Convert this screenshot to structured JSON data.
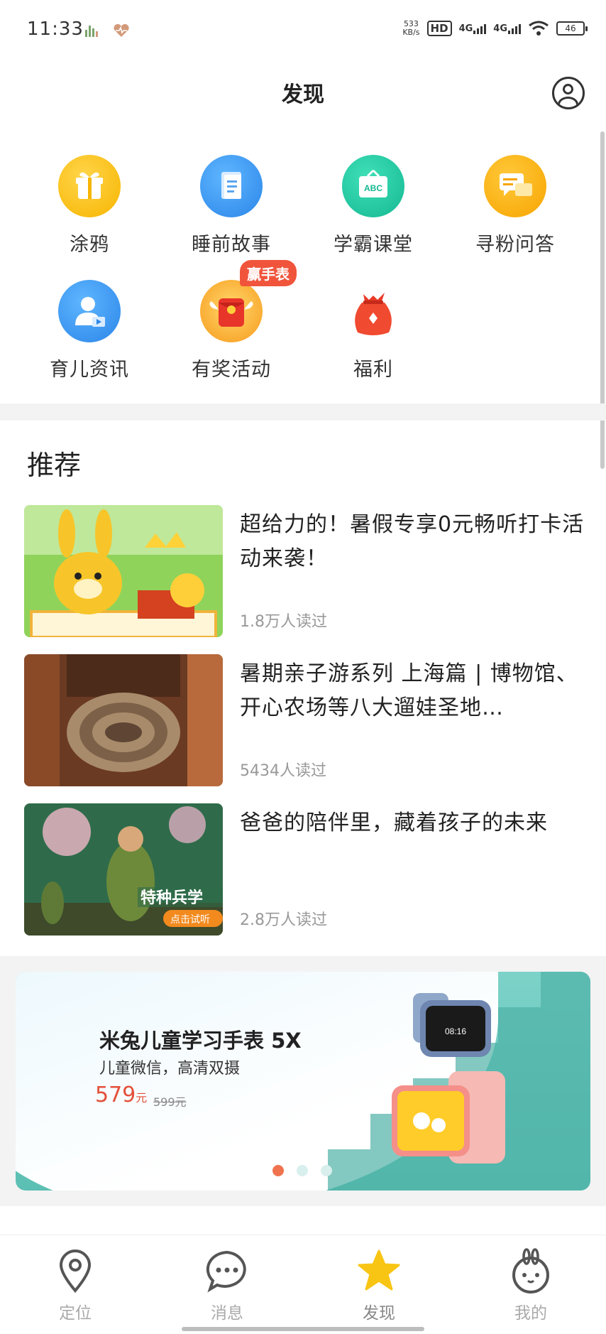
{
  "status_bar": {
    "time": "11:33",
    "speed_value": "533",
    "speed_unit": "KB/s",
    "hd_label": "HD",
    "sim1_label": "4G",
    "sim2_label": "4G",
    "battery": "46"
  },
  "header": {
    "title": "发现"
  },
  "grid": {
    "items": [
      {
        "label": "涂鸦",
        "icon": "gift-icon"
      },
      {
        "label": "睡前故事",
        "icon": "book-icon"
      },
      {
        "label": "学霸课堂",
        "icon": "abc-board-icon"
      },
      {
        "label": "寻粉问答",
        "icon": "chat-bubbles-icon"
      },
      {
        "label": "育儿资讯",
        "icon": "parent-video-icon"
      },
      {
        "label": "有奖活动",
        "icon": "red-envelope-icon"
      },
      {
        "label": "福利",
        "icon": "lucky-bag-icon"
      }
    ],
    "win_badge": "赢手表"
  },
  "recommend": {
    "title": "推荐",
    "articles": [
      {
        "title": "超给力的！暑假专享0元畅听打卡活动来袭！",
        "reads": "1.8万人读过"
      },
      {
        "title": "暑期亲子游系列 上海篇 | 博物馆、开心农场等八大遛娃圣地…",
        "reads": "5434人读过"
      },
      {
        "title": "爸爸的陪伴里，藏着孩子的未来",
        "reads": "2.8万人读过"
      }
    ],
    "thumb3_overlay": "特种兵学",
    "thumb3_button": "点击试听"
  },
  "banner": {
    "title": "米兔儿童学习手表 5X",
    "subtitle": "儿童微信，高清双摄",
    "price": "579",
    "price_unit": "元",
    "old_price": "599元",
    "watch_time": "08:16",
    "slides": 3,
    "active_slide": 1
  },
  "bottom_nav": {
    "items": [
      {
        "label": "定位",
        "icon": "location-pin-icon"
      },
      {
        "label": "消息",
        "icon": "message-bubble-icon"
      },
      {
        "label": "发现",
        "icon": "star-icon"
      },
      {
        "label": "我的",
        "icon": "bunny-face-icon"
      }
    ],
    "active": 2
  },
  "colors": {
    "accent_star": "#f9c514",
    "price_red": "#e4503a",
    "badge_red": "#f0553c"
  }
}
